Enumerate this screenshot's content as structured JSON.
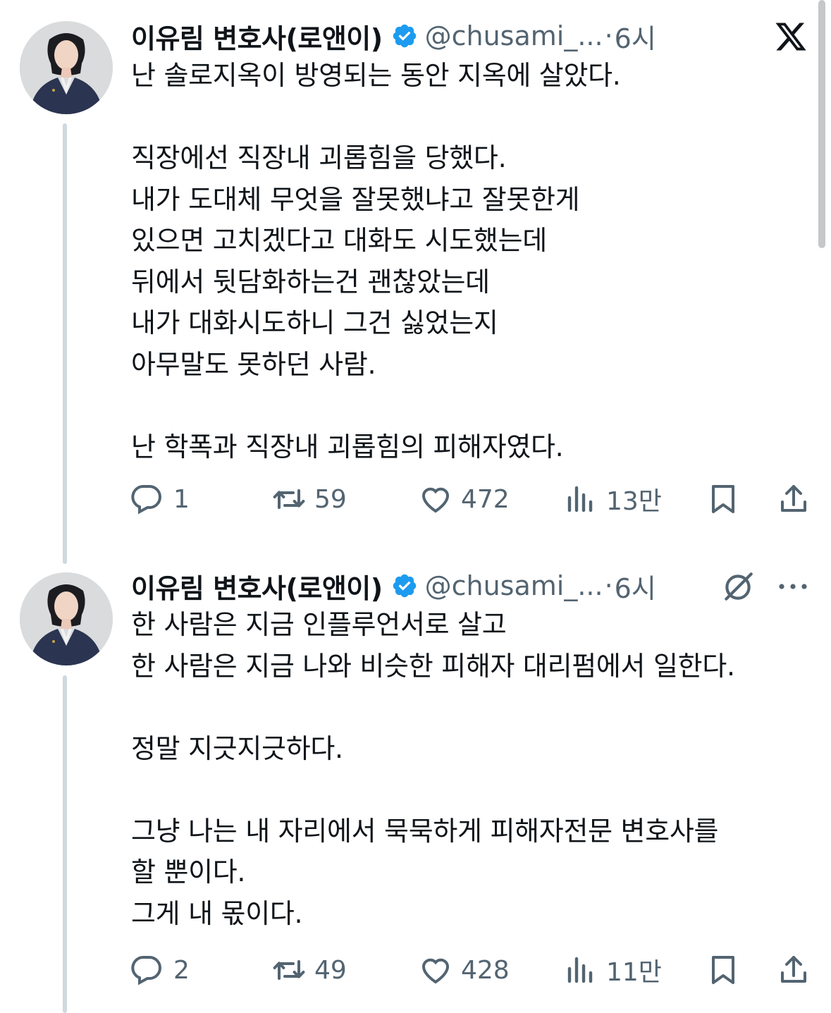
{
  "tweets": [
    {
      "author": {
        "name": "이유림 변호사(로앤이)",
        "handle": "@chusami_...",
        "verified": true
      },
      "time": "6시",
      "text": "난 솔로지옥이 방영되는 동안 지옥에 살았다.\n\n직장에선 직장내 괴롭힘을 당했다.\n내가 도대체 무엇을 잘못했냐고 잘못한게\n있으면 고치겠다고 대화도 시도했는데\n뒤에서 뒷담화하는건 괜찮았는데\n내가 대화시도하니 그건 싫었는지\n아무말도 못하던 사람.\n\n난 학폭과 직장내 괴롭힘의 피해자였다.",
      "stats": {
        "replies": "1",
        "retweets": "59",
        "likes": "472",
        "views": "13만"
      }
    },
    {
      "author": {
        "name": "이유림 변호사(로앤이)",
        "handle": "@chusami_...",
        "verified": true
      },
      "time": "6시",
      "text": "한 사람은 지금 인플루언서로 살고\n한 사람은 지금 나와 비슷한 피해자 대리펌에서 일한다.\n\n정말 지긋지긋하다.\n\n그냥 나는 내 자리에서 묵묵하게 피해자전문 변호사를\n할 뿐이다.\n그게 내 몫이다.",
      "stats": {
        "replies": "2",
        "retweets": "49",
        "likes": "428",
        "views": "11만"
      }
    }
  ],
  "header_dot": "·",
  "icons": {
    "top_right": "x-logo-icon",
    "grok": "grok-icon",
    "more": "more-icon",
    "actions": [
      "reply-icon",
      "retweet-icon",
      "like-icon",
      "views-icon",
      "bookmark-icon",
      "share-icon"
    ]
  },
  "colors": {
    "text": "#0f1419",
    "secondary": "#536471",
    "verified": "#1d9bf0",
    "thread_line": "#cfd9de"
  }
}
